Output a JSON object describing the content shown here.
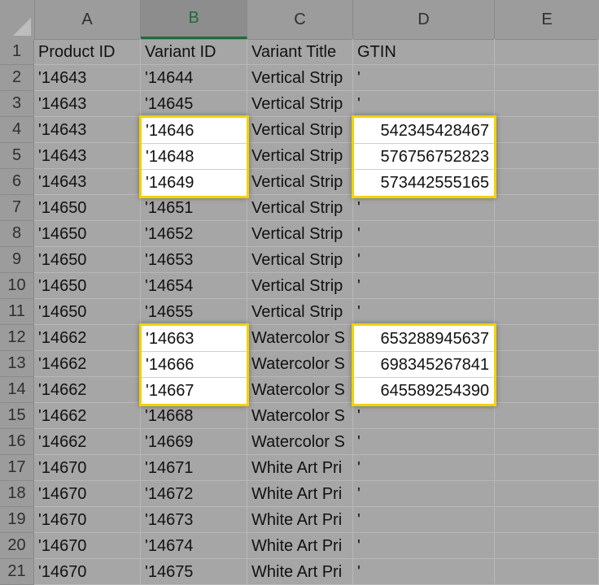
{
  "columns": [
    "A",
    "B",
    "C",
    "D",
    "E"
  ],
  "active_column": "B",
  "rows": [
    {
      "n": "1",
      "a": "Product ID",
      "b": "Variant ID",
      "c": "Variant Title",
      "d": "GTIN"
    },
    {
      "n": "2",
      "a": "'14643",
      "b": "'14644",
      "c": "Vertical Strip",
      "d": "'"
    },
    {
      "n": "3",
      "a": "'14643",
      "b": "'14645",
      "c": "Vertical Strip",
      "d": "'"
    },
    {
      "n": "4",
      "a": "'14643",
      "b": "'14646",
      "c": "Vertical Strip",
      "d": "542345428467"
    },
    {
      "n": "5",
      "a": "'14643",
      "b": "'14648",
      "c": "Vertical Strip",
      "d": "576756752823"
    },
    {
      "n": "6",
      "a": "'14643",
      "b": "'14649",
      "c": "Vertical Strip",
      "d": "573442555165"
    },
    {
      "n": "7",
      "a": "'14650",
      "b": "'14651",
      "c": "Vertical Strip",
      "d": "'"
    },
    {
      "n": "8",
      "a": "'14650",
      "b": "'14652",
      "c": "Vertical Strip",
      "d": "'"
    },
    {
      "n": "9",
      "a": "'14650",
      "b": "'14653",
      "c": "Vertical Strip",
      "d": "'"
    },
    {
      "n": "10",
      "a": "'14650",
      "b": "'14654",
      "c": "Vertical Strip",
      "d": "'"
    },
    {
      "n": "11",
      "a": "'14650",
      "b": "'14655",
      "c": "Vertical Strip",
      "d": "'"
    },
    {
      "n": "12",
      "a": "'14662",
      "b": "'14663",
      "c": "Watercolor S",
      "d": "653288945637"
    },
    {
      "n": "13",
      "a": "'14662",
      "b": "'14666",
      "c": "Watercolor S",
      "d": "698345267841"
    },
    {
      "n": "14",
      "a": "'14662",
      "b": "'14667",
      "c": "Watercolor S",
      "d": "645589254390"
    },
    {
      "n": "15",
      "a": "'14662",
      "b": "'14668",
      "c": "Watercolor S",
      "d": "'"
    },
    {
      "n": "16",
      "a": "'14662",
      "b": "'14669",
      "c": "Watercolor S",
      "d": "'"
    },
    {
      "n": "17",
      "a": "'14670",
      "b": "'14671",
      "c": "White Art Pri",
      "d": "'"
    },
    {
      "n": "18",
      "a": "'14670",
      "b": "'14672",
      "c": "White Art Pri",
      "d": "'"
    },
    {
      "n": "19",
      "a": "'14670",
      "b": "'14673",
      "c": "White Art Pri",
      "d": "'"
    },
    {
      "n": "20",
      "a": "'14670",
      "b": "'14674",
      "c": "White Art Pri",
      "d": "'"
    },
    {
      "n": "21",
      "a": "'14670",
      "b": "'14675",
      "c": "White Art Pri",
      "d": "'"
    }
  ],
  "highlight_color": "#f2d200"
}
